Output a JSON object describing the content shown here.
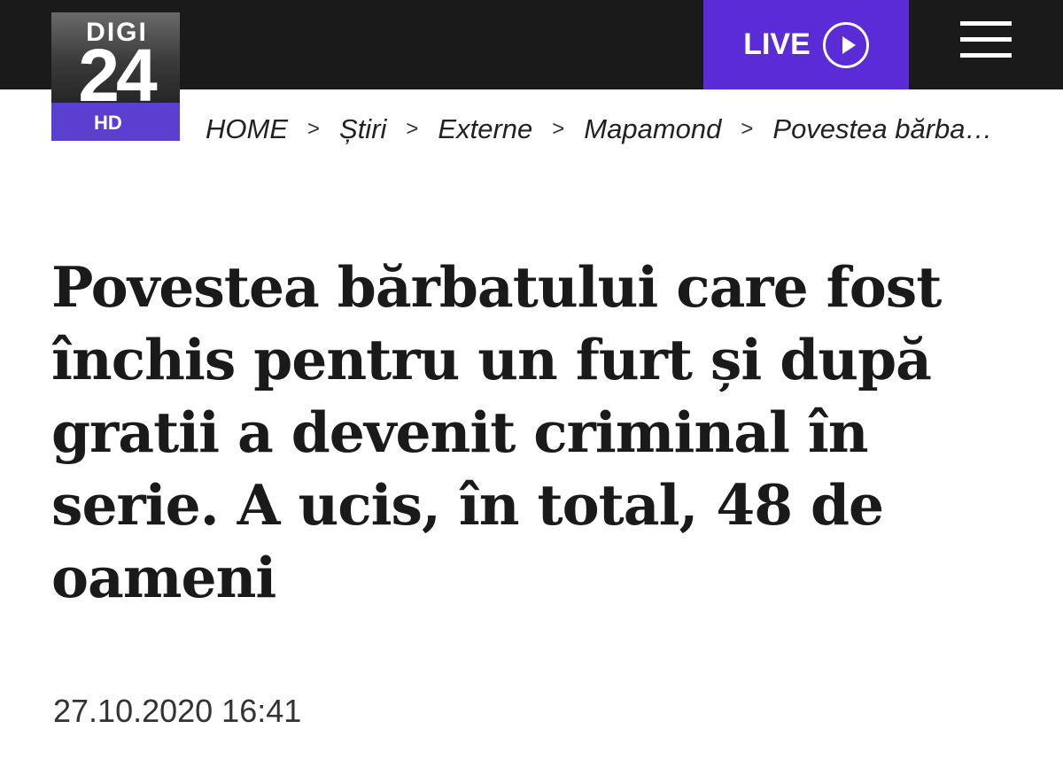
{
  "header": {
    "logo": {
      "word": "DIGI",
      "number": "24",
      "badge": "HD"
    },
    "live_label": "LIVE",
    "live_icon": "play-circle-icon",
    "menu_icon": "hamburger-menu-icon"
  },
  "breadcrumb": {
    "items": [
      "HOME",
      "Știri",
      "Externe",
      "Mapamond",
      "Povestea bărba…"
    ],
    "separator": ">"
  },
  "article": {
    "title": "Povestea bărbatului care fost închis pentru un furt și după gratii a devenit criminal în serie. A ucis, în total, 48 de oameni",
    "date": "27.10.2020 16:41"
  },
  "colors": {
    "topbar": "#1a1a1a",
    "live_bg": "#5b2bd8",
    "logo_badge": "#5a3fd0"
  }
}
